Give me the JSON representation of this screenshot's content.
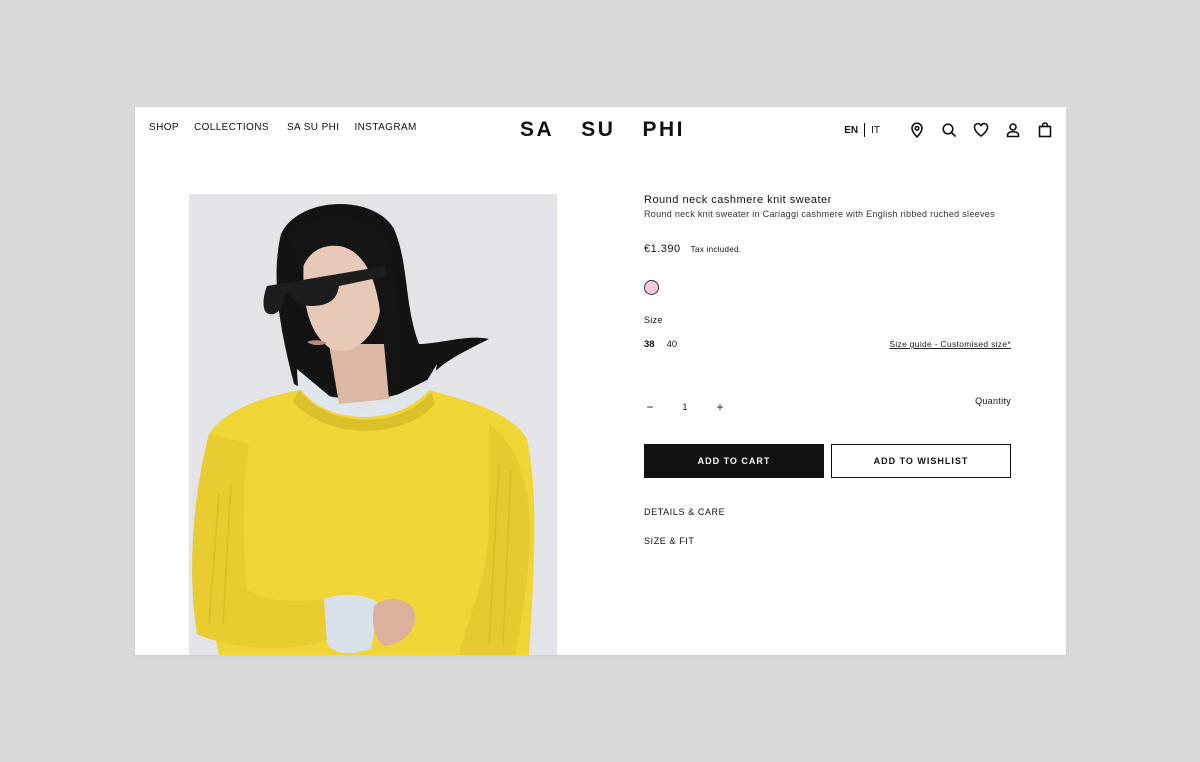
{
  "nav": {
    "items": [
      "SHOP",
      "COLLECTIONS",
      "SA SU PHI",
      "INSTAGRAM"
    ]
  },
  "brand": {
    "logo_parts": [
      "SA",
      "SU",
      "PHI"
    ]
  },
  "header": {
    "lang_active": "EN",
    "lang_other": "IT",
    "icons": [
      "location-pin-icon",
      "search-icon",
      "heart-icon",
      "user-icon",
      "shopping-bag-icon"
    ]
  },
  "product": {
    "title": "Round neck cashmere knit sweater",
    "subtitle": "Round neck knit sweater in Cariaggi cashmere with English ribbed ruched sleeves",
    "price": "€1.390",
    "tax_note": "Tax included.",
    "swatch_color": "#f3c9de",
    "size_label": "Size",
    "sizes": [
      "38",
      "40"
    ],
    "selected_size": "38",
    "size_guide": "Size guide - Customised size*",
    "qty_minus": "−",
    "quantity": "1",
    "qty_plus": "+",
    "quantity_label": "Quantity",
    "add_to_cart": "ADD TO CART",
    "add_to_wishlist": "ADD TO WISHLIST",
    "details_care": "DETAILS & CARE",
    "size_fit": "SIZE & FIT"
  },
  "colors": {
    "background": "#d9d9d9",
    "primary_button": "#111111",
    "sweater": "#f2d93a"
  }
}
